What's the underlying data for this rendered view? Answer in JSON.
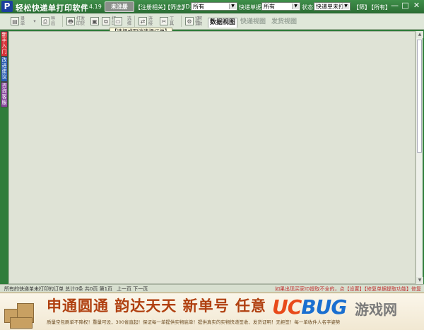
{
  "app": {
    "logo_letter": "P",
    "title": "轻松快递单打印软件",
    "version": "V 4.19",
    "register_badge": "未注册"
  },
  "topbar": {
    "links": [
      "【注册相关】",
      "【筛选】"
    ],
    "id_label": "ID:",
    "id_value": "所有",
    "courier_label": "快递单据:",
    "courier_value": "所有",
    "status_label": "状态:",
    "status_value": "快递单未打",
    "filter_link": "【筛】",
    "all_link": "【所有】",
    "window_buttons": [
      "—",
      "□",
      "✕"
    ]
  },
  "toolbar": {
    "buttons": [
      {
        "icon": "▤",
        "label": "录单"
      },
      {
        "icon": "▾",
        "label": ""
      },
      {
        "icon": "⎙",
        "label": "导出"
      },
      {
        "icon": "🖶",
        "label": "打印"
      },
      {
        "icon": "▦",
        "label": "发货"
      },
      {
        "icon": "▣",
        "label": ""
      },
      {
        "icon": "⧉",
        "label": "打印"
      },
      {
        "icon": "▭",
        "label": ""
      },
      {
        "icon": "▯",
        "label": "选择"
      },
      {
        "icon": "⇄",
        "label": "连接"
      },
      {
        "icon": "✂",
        "label": "工具"
      },
      {
        "icon": "⚙",
        "label": "设置"
      },
      {
        "icon": "?",
        "label": "帮助"
      }
    ],
    "tabs": [
      "数据视图",
      "快递视图",
      "发货视图"
    ],
    "tooltip": "【选择或取消选择订单】"
  },
  "sidebar": {
    "tabs": [
      {
        "label": "新手入门",
        "color": "#d8343a"
      },
      {
        "label": "改进建议",
        "color": "#2a5fb5"
      },
      {
        "label": "咨询客服",
        "color": "#8a4aa0"
      }
    ]
  },
  "statusbar": {
    "left": "所有的快递单未打印的订单  总计0条 共0页 第1页",
    "pager": "上一页  下一页",
    "right": "如果出现买家ID提取不全的，点【设置】【修复单据提取功能】修复"
  },
  "ad": {
    "headline": "申通圆通 韵达天天 新单号 任意",
    "sub": "质量空包刷单不降权！重量可设，300省直起！保证每一单提供实物底单！提供真实的实物快递签收、发货证明！无拒签！每一单收件人名字姿势"
  },
  "watermark": {
    "logo_a": "UC",
    "logo_b": "BUG",
    "text": "游戏网"
  }
}
